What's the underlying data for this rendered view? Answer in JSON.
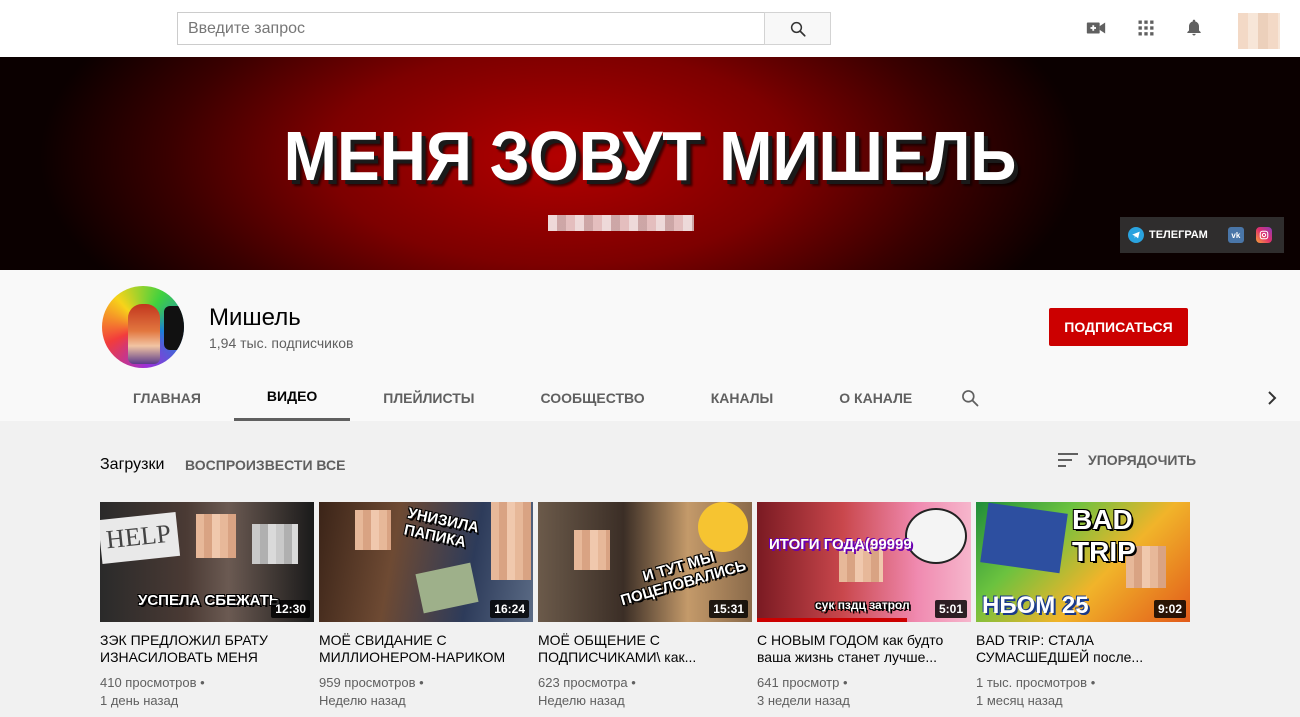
{
  "header": {
    "search_placeholder": "Введите запрос",
    "icons": [
      "search-icon",
      "create-video-icon",
      "apps-icon",
      "notifications-bell-icon"
    ]
  },
  "banner": {
    "title": "МЕНЯ ЗОВУТ МИШЕЛЬ",
    "links": [
      {
        "label": "ТЕЛЕГРАМ",
        "icon": "telegram-icon"
      },
      {
        "label": "",
        "icon": "vk-icon"
      },
      {
        "label": "",
        "icon": "instagram-icon"
      }
    ],
    "vk_glyph": "vk"
  },
  "channel": {
    "name": "Мишель",
    "subscribers": "1,94 тыс. подписчиков",
    "subscribe_label": "ПОДПИСАТЬСЯ",
    "tabs": [
      {
        "label": "ГЛАВНАЯ",
        "active": false
      },
      {
        "label": "ВИДЕО",
        "active": true
      },
      {
        "label": "ПЛЕЙЛИСТЫ",
        "active": false
      },
      {
        "label": "СООБЩЕСТВО",
        "active": false
      },
      {
        "label": "КАНАЛЫ",
        "active": false
      },
      {
        "label": "О КАНАЛЕ",
        "active": false
      }
    ]
  },
  "uploads": {
    "title": "Загрузки",
    "play_all": "ВОСПРОИЗВЕСТИ ВСЕ",
    "sort_label": "УПОРЯДОЧИТЬ",
    "videos": [
      {
        "title": "ЗЭК ПРЕДЛОЖИЛ БРАТУ ИЗНАСИЛОВАТЬ МЕНЯ",
        "duration": "12:30",
        "views": "410 просмотров",
        "age": "1 день назад",
        "thumb_text": "УСПЕЛА СБЕЖАТЬ",
        "thumb_sign": "HELP"
      },
      {
        "title": "МОЁ СВИДАНИЕ С МИЛЛИОНЕРОМ-НАРИКОМ",
        "duration": "16:24",
        "views": "959 просмотров",
        "age": "Неделю назад",
        "thumb_text": "УНИЗИЛА ПАПИКА"
      },
      {
        "title": "МОЁ ОБЩЕНИЕ С ПОДПИСЧИКАМИ\\ как...",
        "duration": "15:31",
        "views": "623 просмотра",
        "age": "Неделю назад",
        "thumb_text": "И ТУТ МЫ ПОЦЕЛОВАЛИСЬ"
      },
      {
        "title": "С НОВЫМ ГОДОМ как будто ваша жизнь станет лучше...",
        "duration": "5:01",
        "views": "641 просмотр",
        "age": "3 недели назад",
        "thumb_text": "ИТОГИ ГОДА(99999",
        "thumb_text2": "сук пздц затрол"
      },
      {
        "title": "BAD TRIP: СТАЛА СУМАСШЕДШЕЙ после...",
        "duration": "9:02",
        "views": "1 тыс. просмотров",
        "age": "1 месяц назад",
        "thumb_text": "BAD TRIP",
        "thumb_text2": "НБОМ 25"
      }
    ]
  }
}
